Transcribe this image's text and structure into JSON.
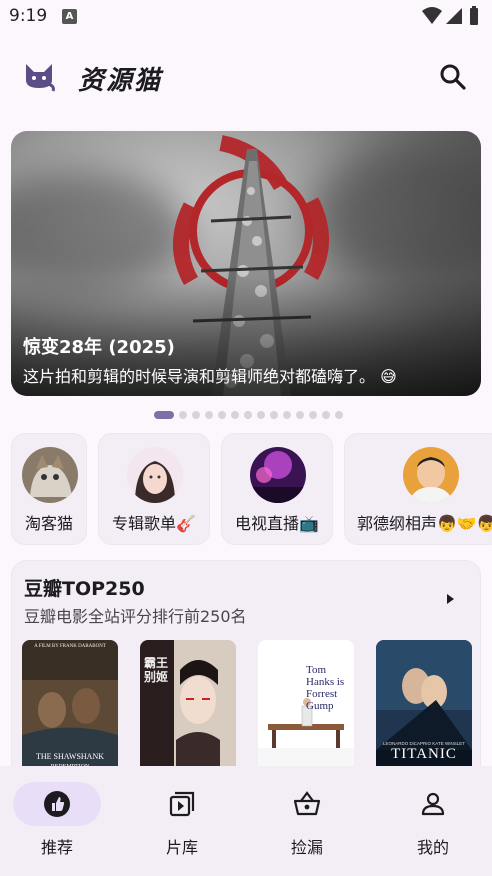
{
  "status_bar": {
    "time": "9:19",
    "indicator": "A"
  },
  "app_bar": {
    "title": "资源猫",
    "logo_icon": "cat-icon",
    "search_icon": "search-icon"
  },
  "banner": {
    "title": "惊变28年 (2025)",
    "subtitle": "这片拍和剪辑的时候导演和剪辑师绝对都磕嗨了。 😅",
    "page_count": 14,
    "active_page": 1
  },
  "quick_links": [
    {
      "label": "淘客猫",
      "avatar": "cat-photo"
    },
    {
      "label": "专辑歌单🎸",
      "avatar": "girl-photo"
    },
    {
      "label": "电视直播📺",
      "avatar": "concert-photo"
    },
    {
      "label": "郭德纲相声👦🤝👦",
      "avatar": "man-photo"
    }
  ],
  "douban": {
    "title": "豆瓣TOP250",
    "subtitle": "豆瓣电影全站评分排行前250名",
    "arrow_icon": "play-arrow-icon",
    "posters": [
      {
        "top_text": "A FILM BY FRANK DARABONT",
        "main_text": "THE SHAWSHANK",
        "sub_text": "REDEMPTION"
      },
      {
        "top_text": "",
        "main_text": "霸王别姬",
        "sub_text": ""
      },
      {
        "top_text": "",
        "main_text": "Tom Hanks is Forrest Gump",
        "sub_text": ""
      },
      {
        "top_text": "LEONARDO DiCAPRIO   KATE WINSLET",
        "main_text": "TITANIC",
        "sub_text": ""
      }
    ]
  },
  "bottom_nav": [
    {
      "label": "推荐",
      "icon": "thumb-up-icon",
      "active": true
    },
    {
      "label": "片库",
      "icon": "video-library-icon",
      "active": false
    },
    {
      "label": "捡漏",
      "icon": "basket-icon",
      "active": false
    },
    {
      "label": "我的",
      "icon": "person-icon",
      "active": false
    }
  ],
  "colors": {
    "accent": "#7d6fa8",
    "active_pill": "#e8def8",
    "surface": "#f3edf6",
    "background": "#fcf7fc"
  }
}
